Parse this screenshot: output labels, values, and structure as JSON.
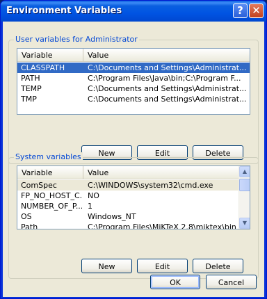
{
  "window": {
    "title": "Environment Variables",
    "help_label": "?",
    "close_label": "✕"
  },
  "user_group": {
    "label": "User variables for Administrator",
    "columns": [
      "Variable",
      "Value"
    ],
    "rows": [
      {
        "variable": "CLASSPATH",
        "value": "C:\\Documents and Settings\\Administrat...",
        "selected": true
      },
      {
        "variable": "PATH",
        "value": "C:\\Program Files\\Java\\bin;C:\\Program F...",
        "selected": false
      },
      {
        "variable": "TEMP",
        "value": "C:\\Documents and Settings\\Administrat...",
        "selected": false
      },
      {
        "variable": "TMP",
        "value": "C:\\Documents and Settings\\Administrat...",
        "selected": false
      }
    ],
    "buttons": {
      "new": "New",
      "edit": "Edit",
      "delete": "Delete"
    }
  },
  "system_group": {
    "label": "System variables",
    "columns": [
      "Variable",
      "Value"
    ],
    "rows": [
      {
        "variable": "ComSpec",
        "value": "C:\\WINDOWS\\system32\\cmd.exe",
        "selected": true
      },
      {
        "variable": "FP_NO_HOST_C...",
        "value": "NO",
        "selected": false
      },
      {
        "variable": "NUMBER_OF_P...",
        "value": "1",
        "selected": false
      },
      {
        "variable": "OS",
        "value": "Windows_NT",
        "selected": false
      },
      {
        "variable": "Path",
        "value": "C:\\Program Files\\MiKTeX 2.8\\miktex\\bin...",
        "selected": false
      }
    ],
    "buttons": {
      "new": "New",
      "edit": "Edit",
      "delete": "Delete"
    }
  },
  "dialog_buttons": {
    "ok": "OK",
    "cancel": "Cancel"
  },
  "icons": {
    "up": "scroll-up-arrow-icon",
    "down": "scroll-down-arrow-icon"
  },
  "colors": {
    "titlebar": "#0054e3",
    "selection": "#316ac5",
    "dialog_bg": "#ece9d8"
  }
}
